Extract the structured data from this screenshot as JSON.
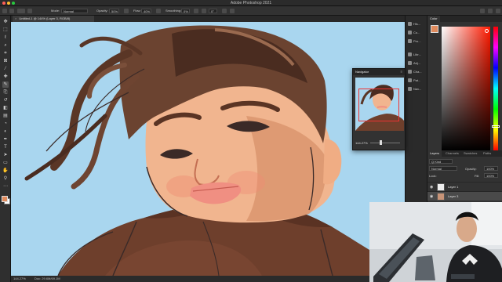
{
  "app": {
    "title": "Adobe Photoshop 2021"
  },
  "options_bar": {
    "mode_label": "Mode:",
    "mode_value": "Normal",
    "opacity_label": "Opacity:",
    "opacity_value": "50%",
    "flow_label": "Flow:",
    "flow_value": "40%",
    "smoothing_label": "Smoothing:",
    "smoothing_value": "0%",
    "angle_value": "0°"
  },
  "document": {
    "tab_title": "Untitled-1 @ 144% (Layer 3, RGB/8)",
    "tab_close": "×"
  },
  "status": {
    "zoom": "144.27%",
    "doc_size": "Doc: 29.6M/69.1M"
  },
  "panel_column": {
    "items": [
      {
        "label": "His...",
        "icon": "history-icon"
      },
      {
        "label": "Co...",
        "icon": "comments-icon"
      },
      {
        "label": "Pro...",
        "icon": "properties-icon"
      },
      {
        "label": "Libr...",
        "icon": "libraries-icon"
      },
      {
        "label": "Adj...",
        "icon": "adjustments-icon"
      },
      {
        "label": "Cha...",
        "icon": "channels-icon"
      },
      {
        "label": "Pat...",
        "icon": "paths-icon"
      },
      {
        "label": "Nav...",
        "icon": "navigator-icon"
      }
    ]
  },
  "color_panel": {
    "tab": "Color",
    "foreground": "#e08a5c",
    "background": "#ffffff"
  },
  "navigator": {
    "title": "Navigator",
    "zoom": "144.27%"
  },
  "layers": {
    "tabs": [
      "Layers",
      "Channels",
      "Swatches",
      "Paths"
    ],
    "filter_label": "Q Kind",
    "blend_mode": "Normal",
    "opacity_label": "Opacity:",
    "opacity_value": "100%",
    "lock_label": "Lock:",
    "fill_label": "Fill:",
    "fill_value": "100%",
    "items": [
      {
        "name": "Layer 1",
        "selected": false
      },
      {
        "name": "Layer 3",
        "selected": true
      }
    ]
  },
  "colors": {
    "canvas_sky": "#a9d6ef",
    "accent": "#e08a5c"
  }
}
